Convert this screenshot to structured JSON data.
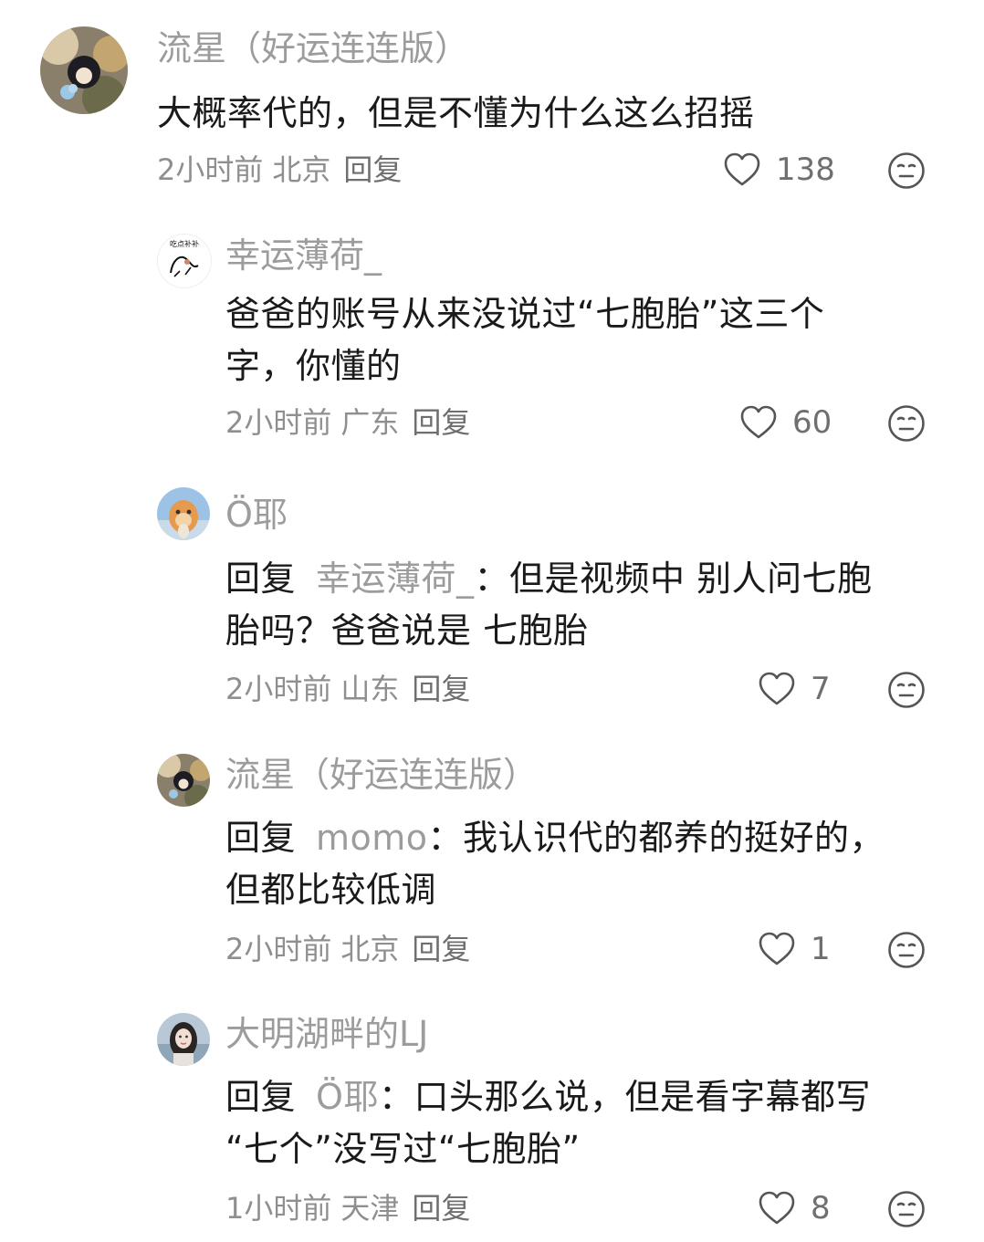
{
  "comments": [
    {
      "name": "流星（好运连连版）",
      "text": "大概率代的，但是不懂为什么这么招摇",
      "time": "2小时前",
      "location": "北京",
      "reply_label": "回复",
      "likes": "138"
    },
    {
      "name": "幸运薄荷_",
      "avatar_caption": "吃点补补",
      "text_line1": "爸爸的账号从来没说过“七胞胎”这三个",
      "text_line2": "字，你懂的",
      "time": "2小时前",
      "location": "广东",
      "reply_label": "回复",
      "likes": "60"
    },
    {
      "name": "Ö耶",
      "reply_kw": "回复",
      "reply_to": "幸运薄荷_",
      "text_line1": "：但是视频中 别人问七胞",
      "text_line2": "胎吗？爸爸说是 七胞胎",
      "time": "2小时前",
      "location": "山东",
      "reply_label": "回复",
      "likes": "7"
    },
    {
      "name": "流星（好运连连版）",
      "reply_kw": "回复",
      "reply_to": "momo",
      "text_line1": "：我认识代的都养的挺好的，",
      "text_line2": "但都比较低调",
      "time": "2小时前",
      "location": "北京",
      "reply_label": "回复",
      "likes": "1"
    },
    {
      "name": "大明湖畔的LJ",
      "reply_kw": "回复",
      "reply_to": "Ö耶",
      "text_line1": "：口头那么说，但是看字幕都写",
      "text_line2": "“七个”没写过“七胞胎”",
      "time": "1小时前",
      "location": "天津",
      "reply_label": "回复",
      "likes": "8"
    }
  ],
  "icons": {
    "like": "heart-outline-icon",
    "dislike": "neutral-face-icon"
  },
  "colors": {
    "name": "#9c9c9c",
    "text": "#1a1a1a",
    "meta": "#8f8f8f"
  }
}
